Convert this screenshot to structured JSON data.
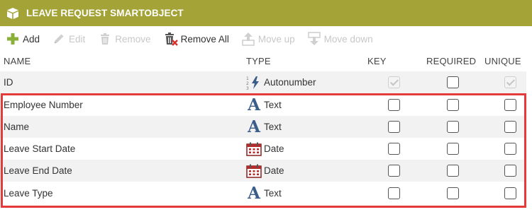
{
  "header": {
    "title": "LEAVE REQUEST SMARTOBJECT"
  },
  "toolbar": {
    "add": "Add",
    "edit": "Edit",
    "remove": "Remove",
    "remove_all": "Remove All",
    "move_up": "Move up",
    "move_down": "Move down"
  },
  "columns": {
    "name": "NAME",
    "type": "TYPE",
    "key": "KEY",
    "required": "REQUIRED",
    "unique": "UNIQUE"
  },
  "rows": [
    {
      "name": "ID",
      "type": "Autonumber",
      "type_icon": "autonumber-icon",
      "key": true,
      "required": false,
      "unique": true,
      "key_disabled": true,
      "unique_disabled": true
    },
    {
      "name": "Employee Number",
      "type": "Text",
      "type_icon": "text-type-icon",
      "key": false,
      "required": false,
      "unique": false
    },
    {
      "name": "Name",
      "type": "Text",
      "type_icon": "text-type-icon",
      "key": false,
      "required": false,
      "unique": false
    },
    {
      "name": "Leave Start Date",
      "type": "Date",
      "type_icon": "calendar-icon",
      "key": false,
      "required": false,
      "unique": false
    },
    {
      "name": "Leave End Date",
      "type": "Date",
      "type_icon": "calendar-icon",
      "key": false,
      "required": false,
      "unique": false
    },
    {
      "name": "Leave Type",
      "type": "Text",
      "type_icon": "text-type-icon",
      "key": false,
      "required": false,
      "unique": false
    }
  ],
  "colors": {
    "header_bg": "#a3a337",
    "highlight": "#e43a3a",
    "text_icon": "#3a5d8a",
    "add_icon": "#8bb03a"
  }
}
